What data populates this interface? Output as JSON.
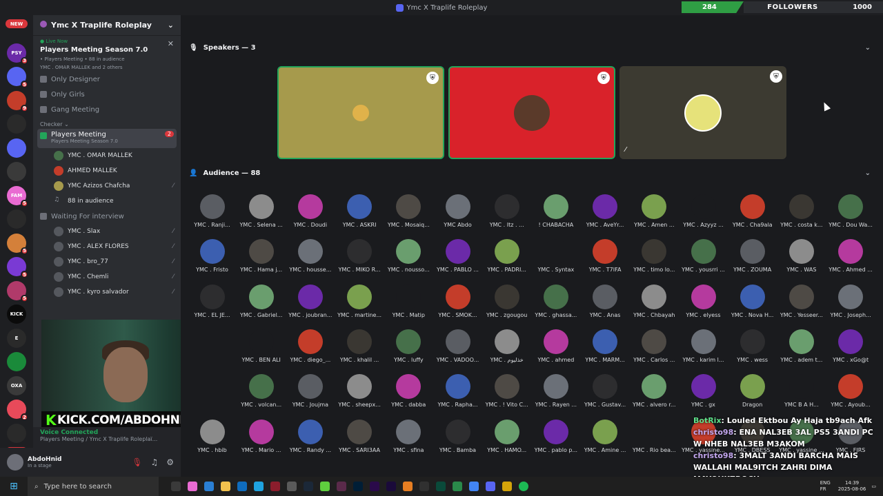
{
  "window": {
    "title": "Ymc X Traplife Roleplay"
  },
  "followers": {
    "current": "284",
    "label": "FOLLOWERS",
    "goal": "1000"
  },
  "servers": [
    {
      "label": "NEW",
      "kind": "pill"
    },
    {
      "label": "PSY",
      "badge": "3"
    },
    {
      "label": "",
      "badge": "5"
    },
    {
      "label": "",
      "badge": "9"
    },
    {
      "label": "",
      "badge": ""
    },
    {
      "label": "",
      "badge": ""
    },
    {
      "label": "",
      "badge": ""
    },
    {
      "label": "FAM",
      "badge": "5"
    },
    {
      "label": "",
      "badge": ""
    },
    {
      "label": "",
      "badge": "5"
    },
    {
      "label": "",
      "badge": "5"
    },
    {
      "label": "",
      "badge": "5"
    },
    {
      "label": "KICK",
      "badge": ""
    },
    {
      "label": "E",
      "badge": ""
    },
    {
      "label": "",
      "badge": ""
    },
    {
      "label": "OXA",
      "badge": ""
    },
    {
      "label": "",
      "badge": "2"
    },
    {
      "label": "",
      "badge": ""
    },
    {
      "label": "NEW",
      "kind": "pill"
    }
  ],
  "guild": {
    "name": "Ymc X Traplife Roleplay"
  },
  "live": {
    "tag": "Live Now",
    "title": "Players Meeting Season 7.0",
    "meta": "• Players Meeting • 88 in audience",
    "people": "YMC . OMAR MALLEK and 2 others"
  },
  "channels_top": [
    "Only Designer",
    "Only Girls",
    "Gang Meeting"
  ],
  "category": "Checker",
  "active_channel": {
    "name": "Players Meeting",
    "sub": "Players Meeting Season 7.0",
    "badge": "2"
  },
  "stage_members": [
    {
      "name": "YMC . OMAR MALLEK"
    },
    {
      "name": "AHMED MALLEK"
    },
    {
      "name": "YMC Azizos Chafcha"
    },
    {
      "name": "88 in audience"
    }
  ],
  "waiting_channel": "Waiting For interview",
  "waiting_members": [
    {
      "name": "YMC . Slax"
    },
    {
      "name": "YMC . ALEX FLORES"
    },
    {
      "name": "YMC . bro_77"
    },
    {
      "name": "YMC . Chemli"
    },
    {
      "name": "YMC . kyro salvador"
    }
  ],
  "kick_banner": {
    "k": "K",
    "text": "KICK.COM/ABDOHNID"
  },
  "voice": {
    "status": "Voice Connected",
    "channel": "Players Meeting / Ymc X Traplife Roleplaï..."
  },
  "user": {
    "name": "AbdoHnid",
    "status": "In a stage"
  },
  "speakers": {
    "label": "Speakers — 3",
    "colors": [
      "#a69a4c",
      "#d9222a",
      "#3c3a31"
    ]
  },
  "audience": {
    "label": "Audience — 88",
    "rows": [
      [
        "YMC . Ranji...",
        "YMC . Selena ...",
        "YMC . Doudi",
        "YMC . ASKRI",
        "YMC . Mosaiq...",
        "YMC Abdo",
        "YMC . Itz . ...",
        "! CHABACHA",
        "YMC . AveYr...",
        "YMC . Amen ...",
        "YMC . Azyyz ...",
        "YMC . Cha9ala",
        "YMC . costa k...",
        "YMC . Dou Wa..."
      ],
      [
        "YMC . Fristo",
        "YMC . Hama j...",
        "YMC . housse...",
        "YMC . MIKO R...",
        "YMC . nousso...",
        "YMC . PABLO ...",
        "YMC . PADRI...",
        "YMC . Syntax",
        "YMC . T7IFA",
        "YMC . timo lo...",
        "YMC . yousrri ...",
        "YMC . ZOUMA",
        "YMC . WAS",
        "YMC . Ahmed ..."
      ],
      [
        "YMC . EL JE...",
        "YMC . Gabriel...",
        "YMC . joubran...",
        "YMC . martine...",
        "YMC . Matip",
        "YMC . SMOK...",
        "YMC . zgougou",
        "YMC . ghassa...",
        "YMC . Anas",
        "YMC . Chbayah",
        "YMC . elyess",
        "YMC . Nova H...",
        "YMC . Yesseer...",
        "YMC . Joseph..."
      ],
      [
        "",
        "YMC . BEN ALI",
        "YMC . diego_...",
        "YMC . khalil ...",
        "YMC . luffy",
        "YMC . VADOO...",
        "YMC . خذليوم",
        "YMC . ahmed",
        "YMC . MARM...",
        "YMC . Carlos ...",
        "YMC . karim l...",
        "YMC . wess",
        "YMC . adem t...",
        "YMC . xGo@t"
      ],
      [
        "",
        "YMC . volcan...",
        "YMC . Joujma",
        "YMC . sheepx...",
        "YMC . dabba",
        "YMC . Rapha...",
        "YMC . ! Vito C...",
        "YMC . Rayen ...",
        "YMC . Gustav...",
        "YMC . alvero r...",
        "YMC . gx",
        "Dragon",
        "YMC B A H...",
        "YMC . Ayoub..."
      ],
      [
        "YMC . hbib",
        "YMC . Mario ...",
        "YMC . Randy ...",
        "YMC . SARI3AA",
        "YMC . sfina",
        "YMC . Bamba",
        "YMC . HAMO...",
        "YMC . pablo p...",
        "YMC . Amine ...",
        "YMC . Rio bea...",
        "YMC . yassine...",
        "YMC . DBESS",
        "YMC . yassine ...",
        "YMC . FJRS"
      ]
    ],
    "colors": [
      "#5a5d63",
      "#8c8c8c",
      "#b53a9e",
      "#3c5fb0",
      "#4e4a45",
      "#6b7078",
      "#2d2d2f",
      "#6a9e6e",
      "#6b2aa8",
      "#7aa04e",
      "#1a1b1e",
      "#c43d2a",
      "#3a3732",
      "#46704a"
    ]
  },
  "chat": [
    {
      "user": "BotRix",
      "text": ": Louled Ektbou Ay Haja tb9ach Afk",
      "bot": true
    },
    {
      "user": "christo98",
      "text": ": ENA NAL3EB 3AL PS5 3ANDI PC W NHEB NAL3EB M3AKOM"
    },
    {
      "user": "christo98",
      "text": ": 3MALT 3ANDI BARCHA MAIS WALLAHI MAL9ITCH ZAHRI DIMA MAYOHKZROCH.."
    }
  ],
  "taskbar": {
    "search": "Type here to search",
    "lang": "ENG FR",
    "time": "14:39",
    "date": "2025-08-06"
  }
}
